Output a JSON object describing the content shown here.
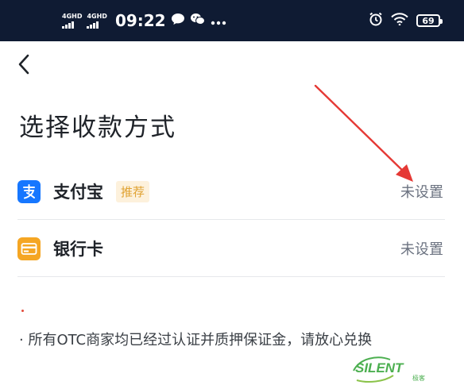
{
  "status_bar": {
    "net1": "4GHD",
    "net2": "4GHD",
    "time": "09:22",
    "battery": "69"
  },
  "page": {
    "title": "选择收款方式"
  },
  "methods": [
    {
      "label": "支付宝",
      "badge": "推荐",
      "status": "未设置",
      "icon": "alipay-icon"
    },
    {
      "label": "银行卡",
      "status": "未设置",
      "icon": "bank-card-icon"
    }
  ],
  "note": "· 所有OTC商家均已经过认证并质押保证金，请放心兑换",
  "watermark": {
    "text": "SILENT",
    "sub": "极客"
  },
  "colors": {
    "status_bar_bg": "#0f1b33",
    "alipay_blue": "#1677ff",
    "bank_orange": "#f5a623",
    "badge_bg": "#fdf1dc",
    "badge_text": "#e0a232",
    "arrow_red": "#e53935",
    "watermark_green": "#4caf50"
  }
}
